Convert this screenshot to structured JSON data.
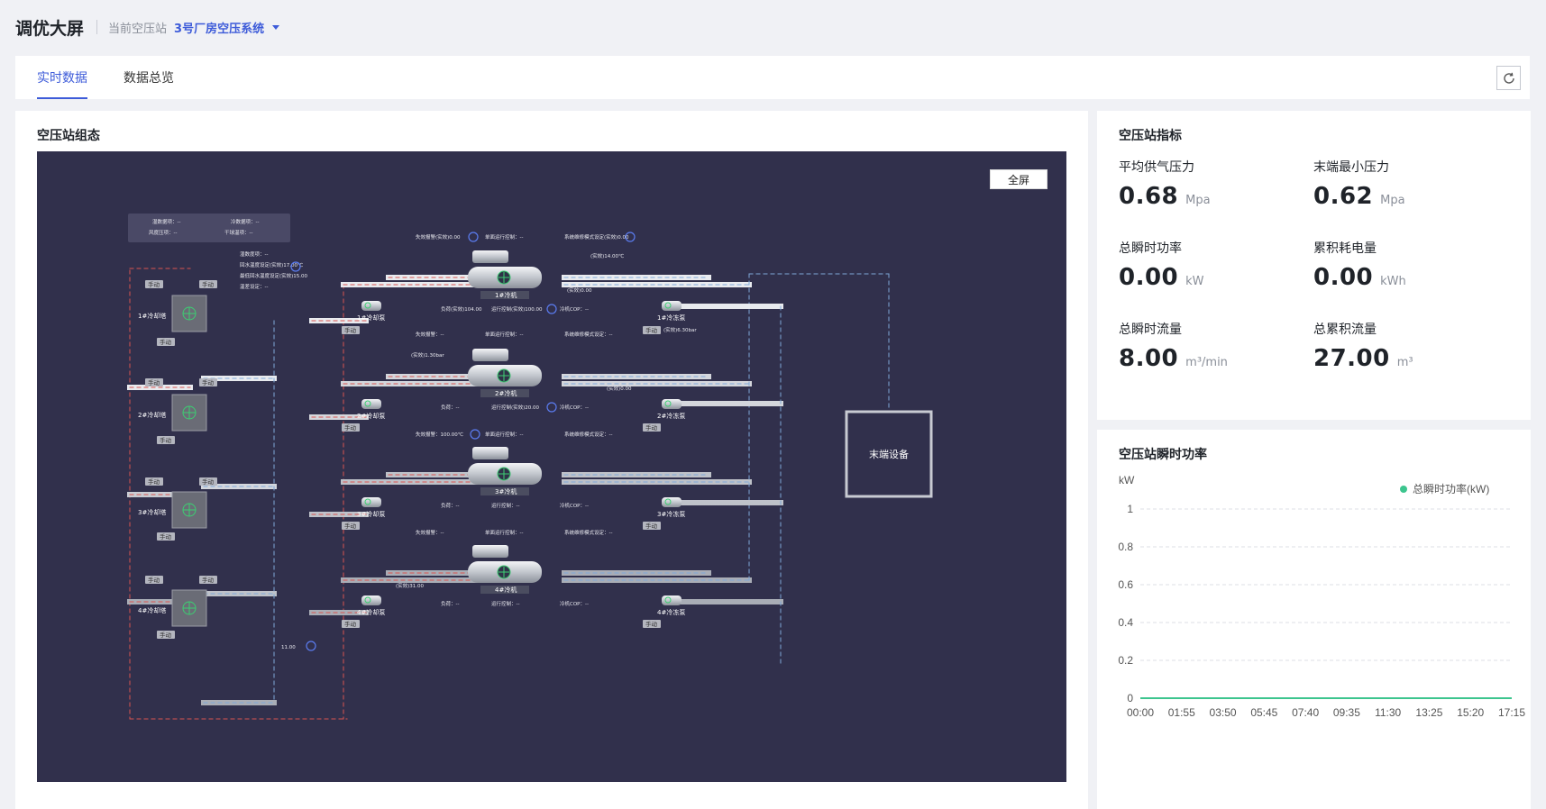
{
  "header": {
    "title": "调优大屏",
    "station_label": "当前空压站",
    "station_value": "3号厂房空压系统"
  },
  "tabs": [
    {
      "label": "实时数据",
      "active": true
    },
    {
      "label": "数据总览",
      "active": false
    }
  ],
  "left_panel": {
    "title": "空压站组态",
    "fullscreen_label": "全屏"
  },
  "diagram": {
    "cooling_towers": [
      "1#冷却塔",
      "2#冷却塔",
      "3#冷却塔",
      "4#冷却塔"
    ],
    "chillers": [
      "1#冷机",
      "2#冷机",
      "3#冷机",
      "4#冷机"
    ],
    "cooling_pumps": [
      "1#冷却泵",
      "2#冷却泵",
      "3#冷却泵",
      "4#冷却泵"
    ],
    "chilled_pumps": [
      "1#冷冻泵",
      "2#冷冻泵",
      "3#冷冻泵",
      "4#冷冻泵"
    ],
    "end_device": "末端设备",
    "manual_tag": "手动",
    "legend_box": {
      "left": [
        "湿数据项：--",
        "风度压项：--"
      ],
      "right": [
        "冷数据项：--",
        "干球温项：--"
      ]
    },
    "tower_params": [
      "湿数度项：--",
      "回水温度设定(实效)17.00℃",
      "最低回水温度设定(实效)15.00",
      "温差设定：--"
    ],
    "chiller_params": [
      [
        "失效报警(实效)0.00",
        "单面运行控制：--",
        "系统维修模式设定(实效)0.00",
        "负荷(实效)104.00",
        "运行控制(实效)100.00",
        "冷机COP：--"
      ],
      [
        "失效报警：--",
        "单面运行控制：--",
        "系统维修模式设定：--",
        "负荷：--",
        "运行控制(实效)20.00",
        "冷机COP：--"
      ],
      [
        "失效报警：100.00℃",
        "单面运行控制：--",
        "系统维修模式设定：--",
        "负荷：--",
        "运行控制：--",
        "冷机COP：--"
      ],
      [
        "失效报警：--",
        "单面运行控制：--",
        "系统维修模式设定：--",
        "负荷：--",
        "运行控制：--",
        "冷机COP：--"
      ]
    ],
    "misc_values": [
      "(实效)14.00℃",
      "(实效)0.00",
      "(实效)6.30bar",
      "(实效)1.30bar",
      "(实效)0.00",
      "(实效)31.00",
      "11.00"
    ]
  },
  "metrics": {
    "title": "空压站指标",
    "items": [
      {
        "label": "平均供气压力",
        "value": "0.68",
        "unit": "Mpa"
      },
      {
        "label": "末端最小压力",
        "value": "0.62",
        "unit": "Mpa"
      },
      {
        "label": "总瞬时功率",
        "value": "0.00",
        "unit": "kW"
      },
      {
        "label": "累积耗电量",
        "value": "0.00",
        "unit": "kWh"
      },
      {
        "label": "总瞬时流量",
        "value": "8.00",
        "unit": "m³/min"
      },
      {
        "label": "总累积流量",
        "value": "27.00",
        "unit": "m³"
      }
    ]
  },
  "power_chart_panel": {
    "title": "空压站瞬时功率"
  },
  "chart_data": {
    "type": "line",
    "ylabel": "kW",
    "ylim": [
      0,
      1
    ],
    "yticks": [
      "0",
      "0.2",
      "0.4",
      "0.6",
      "0.8",
      "1"
    ],
    "x": [
      "00:00",
      "01:55",
      "03:50",
      "05:45",
      "07:40",
      "09:35",
      "11:30",
      "13:25",
      "15:20",
      "17:15"
    ],
    "series": [
      {
        "name": "总瞬时功率(kW)",
        "color": "#3cc58e",
        "values": [
          0,
          0,
          0,
          0,
          0,
          0,
          0,
          0,
          0,
          0
        ]
      }
    ],
    "legend": "top-right",
    "grid": true
  },
  "colors": {
    "accent": "#3d5bd9",
    "canvas_bg": "#31304c",
    "series": "#3cc58e"
  },
  "icons": {
    "caret": "chevron-down-icon",
    "refresh": "refresh-icon"
  }
}
